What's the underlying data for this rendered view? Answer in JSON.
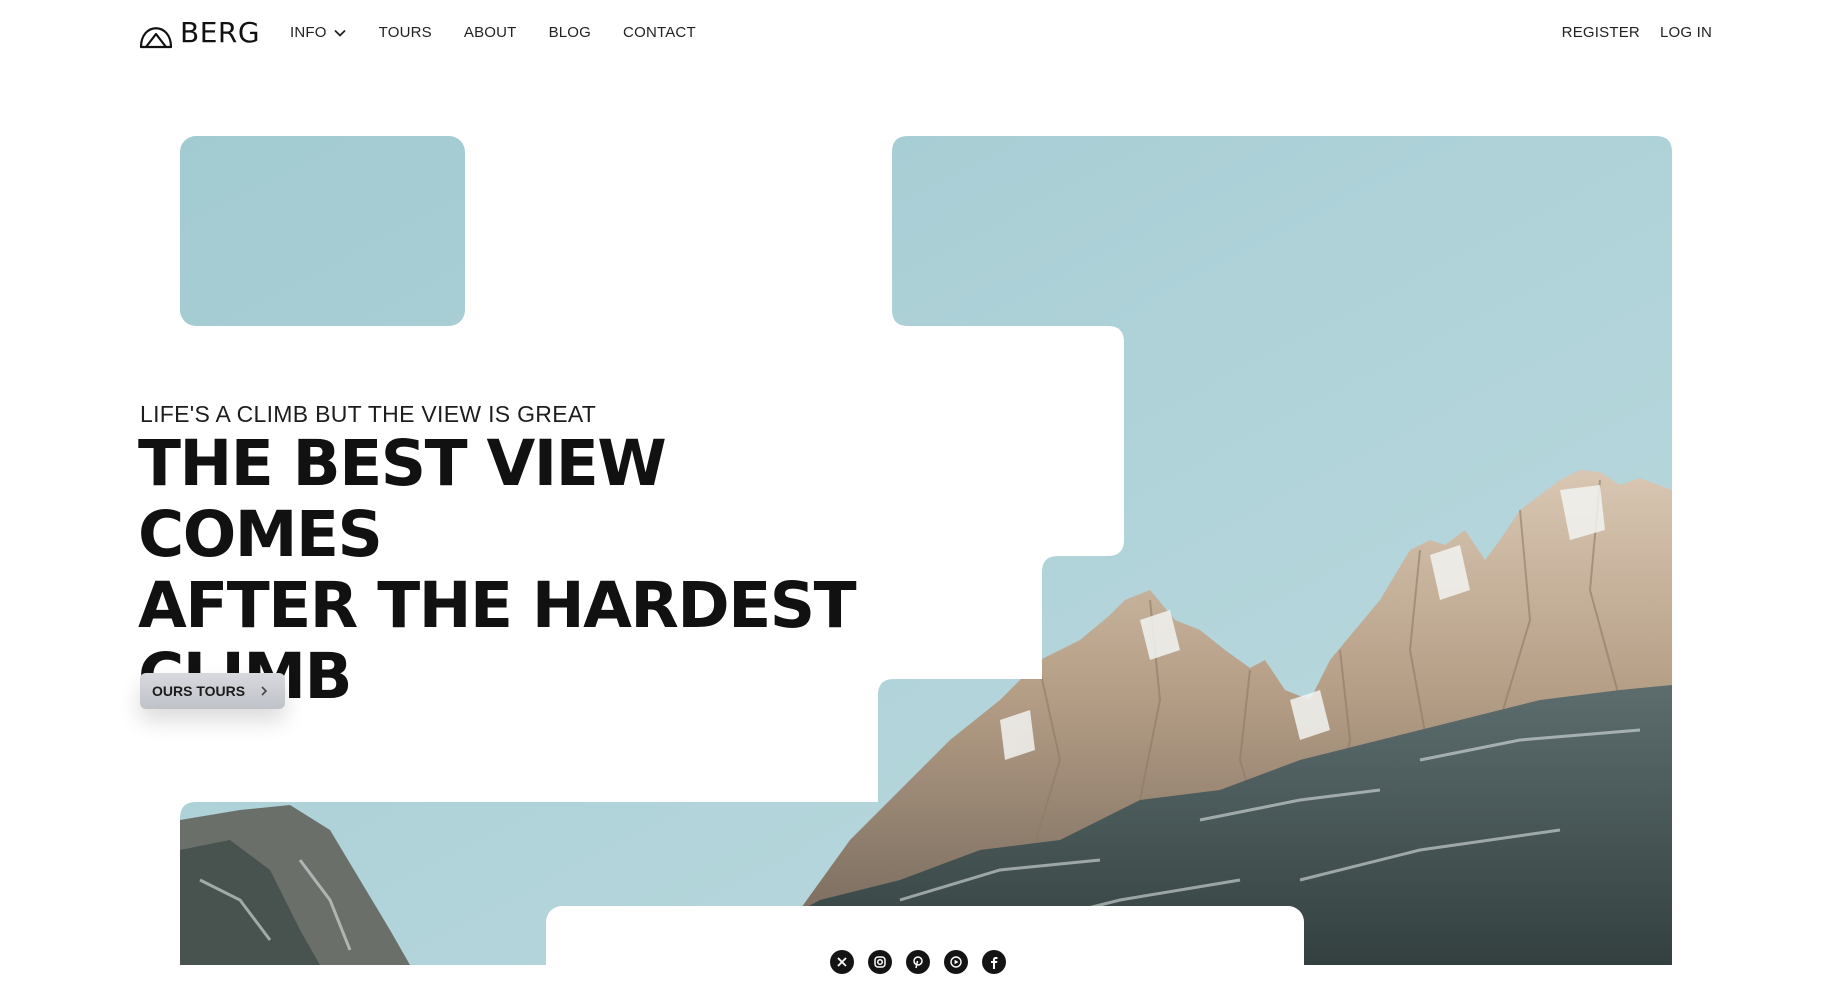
{
  "brand": {
    "name": "BERG",
    "logo_icon": "mountain-arch-icon"
  },
  "nav": {
    "items": [
      {
        "label": "INFO",
        "has_dropdown": true,
        "icon": "chevron-down-icon"
      },
      {
        "label": "TOURS"
      },
      {
        "label": "ABOUT"
      },
      {
        "label": "BLOG"
      },
      {
        "label": "CONTACT"
      }
    ]
  },
  "auth": {
    "register_label": "REGISTER",
    "login_label": "LOG IN"
  },
  "hero": {
    "tagline": "LIFE'S A CLIMB BUT THE VIEW IS GREAT",
    "headline_lines": [
      "THE BEST VIEW COMES",
      "AFTER THE HARDEST",
      "CLIMB"
    ],
    "cta_label": "OURS TOURS",
    "cta_icon": "chevron-right-icon",
    "image_subject": "snowy mountain peaks under pale blue sky"
  },
  "socials": [
    {
      "name": "x",
      "icon": "x-icon"
    },
    {
      "name": "instagram",
      "icon": "instagram-icon"
    },
    {
      "name": "pinterest",
      "icon": "pinterest-icon"
    },
    {
      "name": "youtube",
      "icon": "youtube-icon"
    },
    {
      "name": "facebook",
      "icon": "facebook-icon"
    }
  ],
  "colors": {
    "sky": "#a5cdd5",
    "text": "#111111",
    "button_bg": "#c8cbd1"
  }
}
